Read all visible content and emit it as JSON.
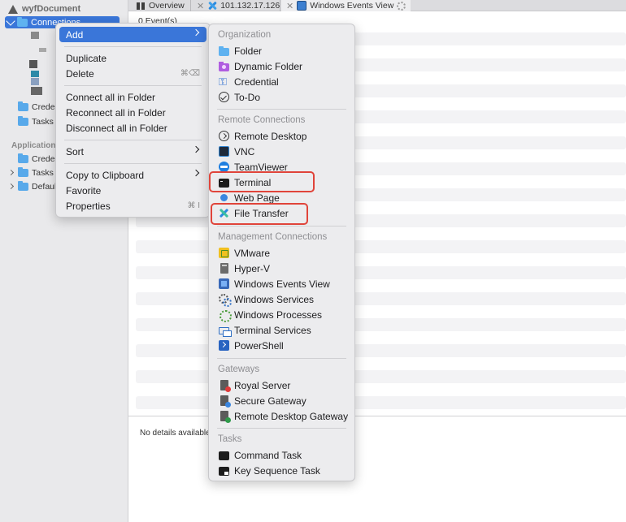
{
  "sidebar": {
    "document_name": "wyfDocument",
    "connections_label": "Connections",
    "items": [
      {
        "label": "Crede"
      },
      {
        "label": "Tasks"
      }
    ],
    "app_section_label": "Application",
    "app_items": [
      {
        "label": "Crede"
      },
      {
        "label": "Tasks"
      },
      {
        "label": "Defaul"
      }
    ]
  },
  "tabs": [
    {
      "label": "Overview"
    },
    {
      "label": "101.132.17.126"
    },
    {
      "label": "Windows Events View"
    }
  ],
  "main": {
    "events_count": "0 Event(s)",
    "details_placeholder": "No details available"
  },
  "context_menu": {
    "add": "Add",
    "duplicate": "Duplicate",
    "delete": "Delete",
    "delete_shortcut": "⌘⌫",
    "connect_all": "Connect all in Folder",
    "reconnect_all": "Reconnect all in Folder",
    "disconnect_all": "Disconnect all in Folder",
    "sort": "Sort",
    "copy_clipboard": "Copy to Clipboard",
    "favorite": "Favorite",
    "properties": "Properties",
    "properties_shortcut": "⌘ I"
  },
  "submenu": {
    "organization": "Organization",
    "folder": "Folder",
    "dynamic_folder": "Dynamic Folder",
    "credential": "Credential",
    "todo": "To-Do",
    "remote_connections": "Remote Connections",
    "remote_desktop": "Remote Desktop",
    "vnc": "VNC",
    "teamviewer": "TeamViewer",
    "terminal": "Terminal",
    "web_page": "Web Page",
    "file_transfer": "File Transfer",
    "management_connections": "Management Connections",
    "vmware": "VMware",
    "hyperv": "Hyper-V",
    "windows_events_view": "Windows Events View",
    "windows_services": "Windows Services",
    "windows_processes": "Windows Processes",
    "terminal_services": "Terminal Services",
    "powershell": "PowerShell",
    "gateways": "Gateways",
    "royal_server": "Royal Server",
    "secure_gateway": "Secure Gateway",
    "remote_desktop_gateway": "Remote Desktop Gateway",
    "tasks": "Tasks",
    "command_task": "Command Task",
    "key_sequence_task": "Key Sequence Task"
  },
  "colors": {
    "accent": "#3a76d9",
    "highlight_box": "#e0443a"
  }
}
